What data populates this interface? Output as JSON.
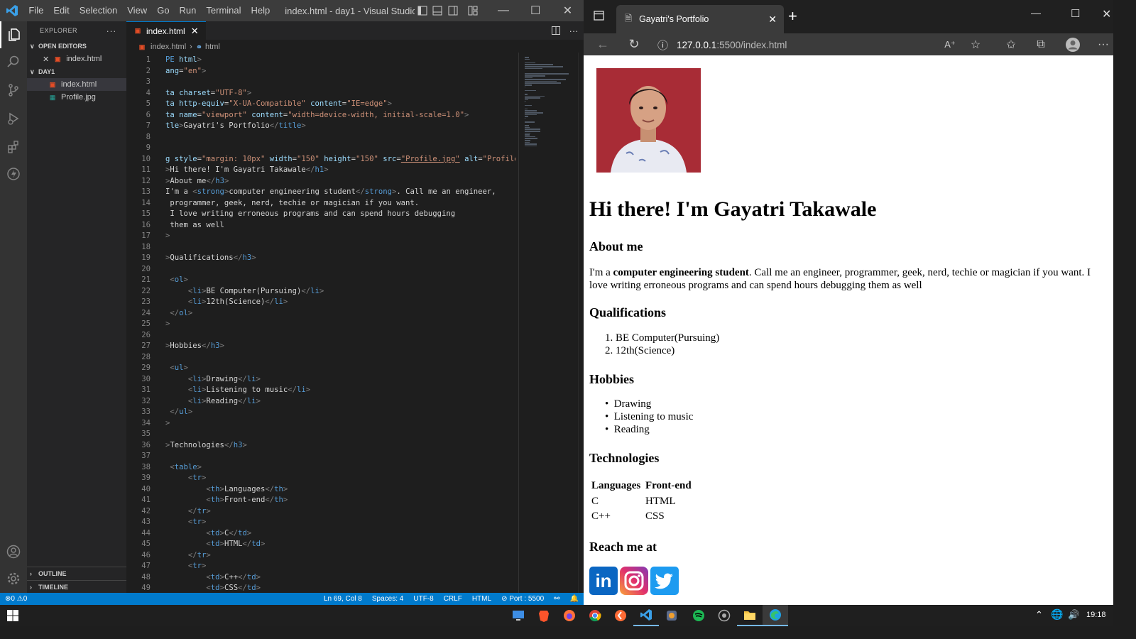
{
  "vscode": {
    "menu": [
      "File",
      "Edit",
      "Selection",
      "View",
      "Go",
      "Run",
      "Terminal",
      "Help"
    ],
    "window_title": "index.html - day1 - Visual Studio ...",
    "explorer_label": "EXPLORER",
    "explorer_more": "···",
    "open_editors_label": "OPEN EDITORS",
    "open_editors": [
      {
        "name": "index.html"
      }
    ],
    "folder_label": "DAY1",
    "files": [
      {
        "name": "index.html",
        "selected": true
      },
      {
        "name": "Profile.jpg",
        "selected": false
      }
    ],
    "outline_label": "OUTLINE",
    "timeline_label": "TIMELINE",
    "tab": {
      "label": "index.html"
    },
    "breadcrumb": {
      "file": "index.html",
      "node": "html"
    },
    "code_lines": [
      [
        [
          "t",
          "PE "
        ],
        [
          "a",
          "html"
        ],
        [
          "p",
          ">"
        ]
      ],
      [
        [
          "a",
          "ang"
        ],
        [
          "w",
          "="
        ],
        [
          "s",
          "\"en\""
        ],
        [
          "p",
          ">"
        ]
      ],
      [],
      [
        [
          "a",
          "ta "
        ],
        [
          "a",
          "charset"
        ],
        [
          "w",
          "="
        ],
        [
          "s",
          "\"UTF-8\""
        ],
        [
          "p",
          ">"
        ]
      ],
      [
        [
          "a",
          "ta "
        ],
        [
          "a",
          "http-equiv"
        ],
        [
          "w",
          "="
        ],
        [
          "s",
          "\"X-UA-Compatible\""
        ],
        [
          "w",
          " "
        ],
        [
          "a",
          "content"
        ],
        [
          "w",
          "="
        ],
        [
          "s",
          "\"IE=edge\""
        ],
        [
          "p",
          ">"
        ]
      ],
      [
        [
          "a",
          "ta "
        ],
        [
          "a",
          "name"
        ],
        [
          "w",
          "="
        ],
        [
          "s",
          "\"viewport\""
        ],
        [
          "w",
          " "
        ],
        [
          "a",
          "content"
        ],
        [
          "w",
          "="
        ],
        [
          "s",
          "\"width=device-width, initial-scale=1.0\""
        ],
        [
          "p",
          ">"
        ]
      ],
      [
        [
          "a",
          "tle"
        ],
        [
          "p",
          ">"
        ],
        [
          "w",
          "Gayatri's Portfolio"
        ],
        [
          "p",
          "</"
        ],
        [
          "t",
          "title"
        ],
        [
          "p",
          ">"
        ]
      ],
      [],
      [],
      [
        [
          "a",
          "g "
        ],
        [
          "a",
          "style"
        ],
        [
          "w",
          "="
        ],
        [
          "s",
          "\"margin: 10px\""
        ],
        [
          "w",
          " "
        ],
        [
          "a",
          "width"
        ],
        [
          "w",
          "="
        ],
        [
          "s",
          "\"150\""
        ],
        [
          "w",
          " "
        ],
        [
          "a",
          "height"
        ],
        [
          "w",
          "="
        ],
        [
          "s",
          "\"150\""
        ],
        [
          "w",
          " "
        ],
        [
          "a",
          "src"
        ],
        [
          "w",
          "="
        ],
        [
          "u",
          "\"Profile.jpg\""
        ],
        [
          "w",
          " "
        ],
        [
          "a",
          "alt"
        ],
        [
          "w",
          "="
        ],
        [
          "s",
          "\"Profile"
        ]
      ],
      [
        [
          "p",
          ">"
        ],
        [
          "w",
          "Hi there! I'm Gayatri Takawale"
        ],
        [
          "p",
          "</"
        ],
        [
          "t",
          "h1"
        ],
        [
          "p",
          ">"
        ]
      ],
      [
        [
          "p",
          ">"
        ],
        [
          "w",
          "About me"
        ],
        [
          "p",
          "</"
        ],
        [
          "t",
          "h3"
        ],
        [
          "p",
          ">"
        ]
      ],
      [
        [
          "w",
          "I'm a "
        ],
        [
          "p",
          "<"
        ],
        [
          "t",
          "strong"
        ],
        [
          "p",
          ">"
        ],
        [
          "w",
          "computer engineering student"
        ],
        [
          "p",
          "</"
        ],
        [
          "t",
          "strong"
        ],
        [
          "p",
          ">"
        ],
        [
          "w",
          ". Call me an engineer,"
        ]
      ],
      [
        [
          "w",
          " programmer, geek, nerd, techie or magician if you want."
        ]
      ],
      [
        [
          "w",
          " I love writing erroneous programs and can spend hours debugging"
        ]
      ],
      [
        [
          "w",
          " them as well"
        ]
      ],
      [
        [
          "p",
          ">"
        ]
      ],
      [],
      [
        [
          "p",
          ">"
        ],
        [
          "w",
          "Qualifications"
        ],
        [
          "p",
          "</"
        ],
        [
          "t",
          "h3"
        ],
        [
          "p",
          ">"
        ]
      ],
      [],
      [
        [
          "w",
          " "
        ],
        [
          "p",
          "<"
        ],
        [
          "t",
          "ol"
        ],
        [
          "p",
          ">"
        ]
      ],
      [
        [
          "w",
          "     "
        ],
        [
          "p",
          "<"
        ],
        [
          "t",
          "li"
        ],
        [
          "p",
          ">"
        ],
        [
          "w",
          "BE Computer(Pursuing)"
        ],
        [
          "p",
          "</"
        ],
        [
          "t",
          "li"
        ],
        [
          "p",
          ">"
        ]
      ],
      [
        [
          "w",
          "     "
        ],
        [
          "p",
          "<"
        ],
        [
          "t",
          "li"
        ],
        [
          "p",
          ">"
        ],
        [
          "w",
          "12th(Science)"
        ],
        [
          "p",
          "</"
        ],
        [
          "t",
          "li"
        ],
        [
          "p",
          ">"
        ]
      ],
      [
        [
          "w",
          " "
        ],
        [
          "p",
          "</"
        ],
        [
          "t",
          "ol"
        ],
        [
          "p",
          ">"
        ]
      ],
      [
        [
          "p",
          ">"
        ]
      ],
      [],
      [
        [
          "p",
          ">"
        ],
        [
          "w",
          "Hobbies"
        ],
        [
          "p",
          "</"
        ],
        [
          "t",
          "h3"
        ],
        [
          "p",
          ">"
        ]
      ],
      [],
      [
        [
          "w",
          " "
        ],
        [
          "p",
          "<"
        ],
        [
          "t",
          "ul"
        ],
        [
          "p",
          ">"
        ]
      ],
      [
        [
          "w",
          "     "
        ],
        [
          "p",
          "<"
        ],
        [
          "t",
          "li"
        ],
        [
          "p",
          ">"
        ],
        [
          "w",
          "Drawing"
        ],
        [
          "p",
          "</"
        ],
        [
          "t",
          "li"
        ],
        [
          "p",
          ">"
        ]
      ],
      [
        [
          "w",
          "     "
        ],
        [
          "p",
          "<"
        ],
        [
          "t",
          "li"
        ],
        [
          "p",
          ">"
        ],
        [
          "w",
          "Listening to music"
        ],
        [
          "p",
          "</"
        ],
        [
          "t",
          "li"
        ],
        [
          "p",
          ">"
        ]
      ],
      [
        [
          "w",
          "     "
        ],
        [
          "p",
          "<"
        ],
        [
          "t",
          "li"
        ],
        [
          "p",
          ">"
        ],
        [
          "w",
          "Reading"
        ],
        [
          "p",
          "</"
        ],
        [
          "t",
          "li"
        ],
        [
          "p",
          ">"
        ]
      ],
      [
        [
          "w",
          " "
        ],
        [
          "p",
          "</"
        ],
        [
          "t",
          "ul"
        ],
        [
          "p",
          ">"
        ]
      ],
      [
        [
          "p",
          ">"
        ]
      ],
      [],
      [
        [
          "p",
          ">"
        ],
        [
          "w",
          "Technologies"
        ],
        [
          "p",
          "</"
        ],
        [
          "t",
          "h3"
        ],
        [
          "p",
          ">"
        ]
      ],
      [],
      [
        [
          "w",
          " "
        ],
        [
          "p",
          "<"
        ],
        [
          "t",
          "table"
        ],
        [
          "p",
          ">"
        ]
      ],
      [
        [
          "w",
          "     "
        ],
        [
          "p",
          "<"
        ],
        [
          "t",
          "tr"
        ],
        [
          "p",
          ">"
        ]
      ],
      [
        [
          "w",
          "         "
        ],
        [
          "p",
          "<"
        ],
        [
          "t",
          "th"
        ],
        [
          "p",
          ">"
        ],
        [
          "w",
          "Languages"
        ],
        [
          "p",
          "</"
        ],
        [
          "t",
          "th"
        ],
        [
          "p",
          ">"
        ]
      ],
      [
        [
          "w",
          "         "
        ],
        [
          "p",
          "<"
        ],
        [
          "t",
          "th"
        ],
        [
          "p",
          ">"
        ],
        [
          "w",
          "Front-end"
        ],
        [
          "p",
          "</"
        ],
        [
          "t",
          "th"
        ],
        [
          "p",
          ">"
        ]
      ],
      [
        [
          "w",
          "     "
        ],
        [
          "p",
          "</"
        ],
        [
          "t",
          "tr"
        ],
        [
          "p",
          ">"
        ]
      ],
      [
        [
          "w",
          "     "
        ],
        [
          "p",
          "<"
        ],
        [
          "t",
          "tr"
        ],
        [
          "p",
          ">"
        ]
      ],
      [
        [
          "w",
          "         "
        ],
        [
          "p",
          "<"
        ],
        [
          "t",
          "td"
        ],
        [
          "p",
          ">"
        ],
        [
          "w",
          "C"
        ],
        [
          "p",
          "</"
        ],
        [
          "t",
          "td"
        ],
        [
          "p",
          ">"
        ]
      ],
      [
        [
          "w",
          "         "
        ],
        [
          "p",
          "<"
        ],
        [
          "t",
          "td"
        ],
        [
          "p",
          ">"
        ],
        [
          "w",
          "HTML"
        ],
        [
          "p",
          "</"
        ],
        [
          "t",
          "td"
        ],
        [
          "p",
          ">"
        ]
      ],
      [
        [
          "w",
          "     "
        ],
        [
          "p",
          "</"
        ],
        [
          "t",
          "tr"
        ],
        [
          "p",
          ">"
        ]
      ],
      [
        [
          "w",
          "     "
        ],
        [
          "p",
          "<"
        ],
        [
          "t",
          "tr"
        ],
        [
          "p",
          ">"
        ]
      ],
      [
        [
          "w",
          "         "
        ],
        [
          "p",
          "<"
        ],
        [
          "t",
          "td"
        ],
        [
          "p",
          ">"
        ],
        [
          "w",
          "C++"
        ],
        [
          "p",
          "</"
        ],
        [
          "t",
          "td"
        ],
        [
          "p",
          ">"
        ]
      ],
      [
        [
          "w",
          "         "
        ],
        [
          "p",
          "<"
        ],
        [
          "t",
          "td"
        ],
        [
          "p",
          ">"
        ],
        [
          "w",
          "CSS"
        ],
        [
          "p",
          "</"
        ],
        [
          "t",
          "td"
        ],
        [
          "p",
          ">"
        ]
      ]
    ],
    "status": {
      "problems": "0",
      "warnings": "0",
      "cursor": "Ln 69, Col 8",
      "spaces": "Spaces: 4",
      "encoding": "UTF-8",
      "eol": "CRLF",
      "language": "HTML",
      "port": "Port : 5500"
    }
  },
  "browser": {
    "tab_title": "Gayatri's Portfolio",
    "url_host": "127.0.0.1",
    "url_rest": ":5500/index.html",
    "page": {
      "h1": "Hi there! I'm Gayatri Takawale",
      "about_heading": "About me",
      "about_pre": "I'm a ",
      "about_strong": "computer engineering student",
      "about_line1_rest": ". Call me an engineer, programmer, geek, nerd, techie or magician if you want. I",
      "about_line2": "love writing erroneous programs and can spend hours debugging them as well",
      "qual_heading": "Qualifications",
      "qualifications": [
        "BE Computer(Pursuing)",
        "12th(Science)"
      ],
      "hobbies_heading": "Hobbies",
      "hobbies": [
        "Drawing",
        "Listening to music",
        "Reading"
      ],
      "tech_heading": "Technologies",
      "table_headers": [
        "Languages",
        "Front-end"
      ],
      "table_rows": [
        [
          "C",
          "HTML"
        ],
        [
          "C++",
          "CSS"
        ]
      ],
      "reach_heading": "Reach me at",
      "social": [
        "in"
      ]
    }
  },
  "taskbar": {
    "time": "19:18"
  },
  "colors": {
    "vscode_blue": "#007acc",
    "linkedin": "#0a66c2",
    "twitter": "#1d9bf0",
    "profile_bg": "#b5303a"
  }
}
